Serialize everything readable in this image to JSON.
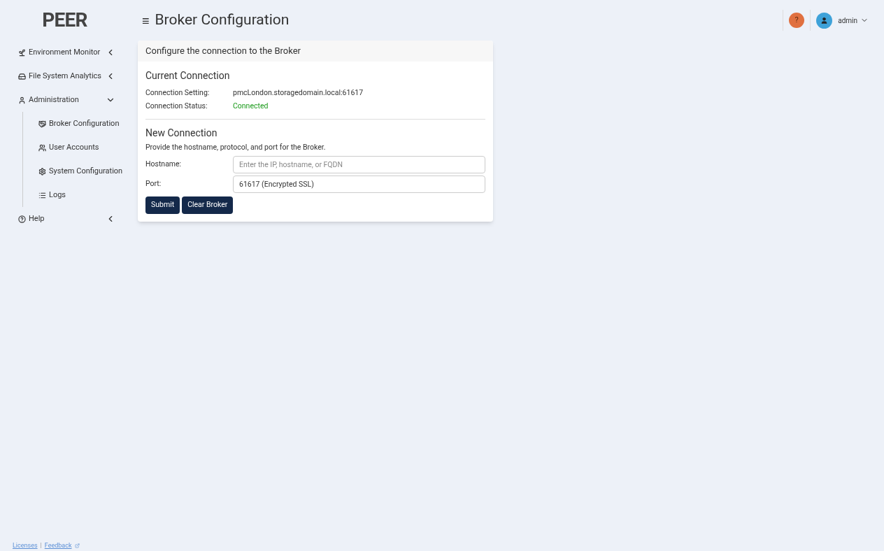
{
  "logo": {
    "text": "PEER"
  },
  "sidebar": {
    "items": [
      {
        "label": "Environment Monitor",
        "expanded": false
      },
      {
        "label": "File System Analytics",
        "expanded": false
      },
      {
        "label": "Administration",
        "expanded": true,
        "children": [
          {
            "label": "Broker Configuration"
          },
          {
            "label": "User Accounts"
          },
          {
            "label": "System Configuration"
          },
          {
            "label": "Logs"
          }
        ]
      },
      {
        "label": "Help",
        "expanded": false
      }
    ]
  },
  "footer": {
    "links": [
      "Licenses",
      "Feedback"
    ],
    "separator": "|"
  },
  "header": {
    "menu_glyph": "≡",
    "title": "Broker Configuration",
    "help_glyph": "?",
    "user": "admin"
  },
  "card": {
    "title": "Configure the connection to the Broker",
    "current": {
      "heading": "Current Connection",
      "rows": [
        {
          "label": "Connection Setting:",
          "value": "pmcLondon.storagedomain.local:61617",
          "kind": "plain"
        },
        {
          "label": "Connection Status:",
          "value": "Connected",
          "kind": "status"
        }
      ]
    },
    "new": {
      "heading": "New Connection",
      "description": "Provide the hostname, protocol, and port for the Broker.",
      "fields": [
        {
          "label": "Hostname:",
          "placeholder": "Enter the IP, hostname, or FQDN"
        },
        {
          "label": "Port:",
          "value": "61617 (Encrypted SSL)"
        }
      ]
    },
    "buttons": [
      "Submit",
      "Clear Broker"
    ]
  }
}
